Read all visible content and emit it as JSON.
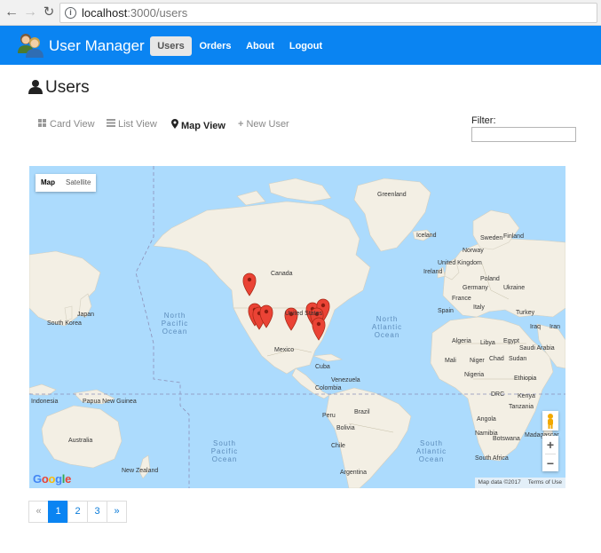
{
  "browser": {
    "url_host": "localhost",
    "url_path": ":3000/users"
  },
  "navbar": {
    "brand": "User Manager",
    "items": [
      {
        "label": "Users",
        "active": true
      },
      {
        "label": "Orders",
        "active": false
      },
      {
        "label": "About",
        "active": false
      },
      {
        "label": "Logout",
        "active": false
      }
    ]
  },
  "page": {
    "title": "Users"
  },
  "views": [
    {
      "label": "Card View",
      "icon": "th-large-icon",
      "active": false
    },
    {
      "label": "List View",
      "icon": "list-icon",
      "active": false
    },
    {
      "label": "Map View",
      "icon": "map-marker-icon",
      "active": true
    },
    {
      "label": "New User",
      "icon": "plus-icon",
      "active": false
    }
  ],
  "filter": {
    "label": "Filter:",
    "value": ""
  },
  "map": {
    "type_buttons": [
      "Map",
      "Satellite"
    ],
    "selected_type": "Map",
    "labels": {
      "greenland": "Greenland",
      "iceland": "Iceland",
      "norway": "Norway",
      "sweden": "Sweden",
      "finland": "Finland",
      "canada": "Canada",
      "united_states": "United States",
      "mexico": "Mexico",
      "cuba": "Cuba",
      "venezuela": "Venezuela",
      "colombia": "Colombia",
      "peru": "Peru",
      "brazil": "Brazil",
      "bolivia": "Bolivia",
      "chile": "Chile",
      "argentina": "Argentina",
      "uk": "United Kingdom",
      "ireland": "Ireland",
      "germany": "Germany",
      "poland": "Poland",
      "ukraine": "Ukraine",
      "france": "France",
      "spain": "Spain",
      "italy": "Italy",
      "algeria": "Algeria",
      "libya": "Libya",
      "egypt": "Egypt",
      "mali": "Mali",
      "niger": "Niger",
      "chad": "Chad",
      "sudan": "Sudan",
      "ethiopia": "Ethiopia",
      "nigeria": "Nigeria",
      "kenya": "Kenya",
      "drc": "DRC",
      "tanzania": "Tanzania",
      "angola": "Angola",
      "namibia": "Namibia",
      "botswana": "Botswana",
      "south_africa": "South Africa",
      "madagascar": "Madagascar",
      "saudi_arabia": "Saudi Arabia",
      "iraq": "Iraq",
      "iran": "Iran",
      "turkey": "Turkey",
      "japan": "Japan",
      "south_korea": "South Korea",
      "indonesia": "Indonesia",
      "papua_new_guinea": "Papua New Guinea",
      "australia": "Australia",
      "new_zealand": "New Zealand"
    },
    "oceans": {
      "north_pacific": "North Pacific Ocean",
      "north_atlantic": "North Atlantic Ocean",
      "south_pacific": "South Pacific Ocean",
      "south_atlantic": "South Atlantic Ocean"
    },
    "markers_count": 9,
    "logo": "Google",
    "attribution": "Map data ©2017",
    "terms": "Terms of Use",
    "zoom_in": "+",
    "zoom_out": "−"
  },
  "pagination": {
    "prev": "«",
    "pages": [
      "1",
      "2",
      "3"
    ],
    "current": "1",
    "next": "»"
  }
}
